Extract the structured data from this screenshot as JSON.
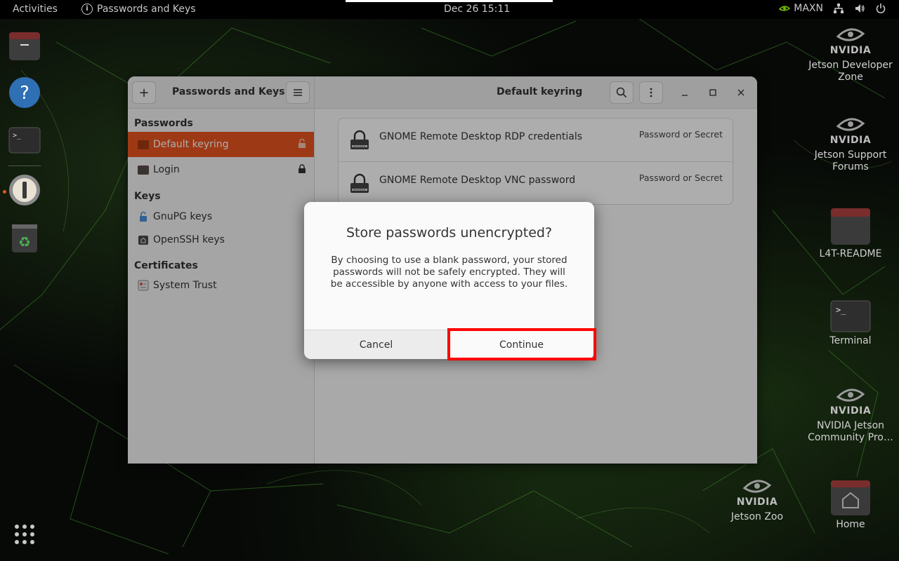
{
  "topbar": {
    "activities": "Activities",
    "app_name": "Passwords and Keys",
    "clock": "Dec 26  15:11",
    "power_mode": "MAXN"
  },
  "desktop": {
    "icons": [
      {
        "label": "Jetson Developer Zone",
        "icon": "nvidia-logo-icon"
      },
      {
        "label": "Jetson Support Forums",
        "icon": "nvidia-logo-icon"
      },
      {
        "label": "L4T-README",
        "icon": "folder-icon"
      },
      {
        "label": "Terminal",
        "icon": "terminal-icon"
      },
      {
        "label": "NVIDIA Jetson Community Pro…",
        "icon": "nvidia-logo-icon"
      },
      {
        "label": "Jetson Zoo",
        "icon": "nvidia-logo-icon"
      },
      {
        "label": "Home",
        "icon": "home-folder-icon"
      }
    ],
    "nvidia_word": "NVIDIA"
  },
  "window": {
    "left_title": "Passwords and Keys",
    "right_title": "Default keyring",
    "sidebar": {
      "passwords_header": "Passwords",
      "keys_header": "Keys",
      "certs_header": "Certificates",
      "items": [
        {
          "label": "Default keyring",
          "selected": true
        },
        {
          "label": "Login",
          "selected": false
        },
        {
          "label": "GnuPG keys"
        },
        {
          "label": "OpenSSH keys"
        },
        {
          "label": "System Trust"
        }
      ]
    },
    "entries": [
      {
        "name": "GNOME Remote Desktop RDP credentials",
        "type": "Password or Secret"
      },
      {
        "name": "GNOME Remote Desktop VNC password",
        "type": "Password or Secret"
      }
    ]
  },
  "dialog": {
    "title": "Store passwords unencrypted?",
    "body": "By choosing to use a blank password, your stored passwords will not be safely encrypted. They will be accessible by anyone with access to your files.",
    "cancel": "Cancel",
    "continue": "Continue"
  },
  "colors": {
    "accent": "#e95420",
    "highlight": "#ff0000"
  }
}
